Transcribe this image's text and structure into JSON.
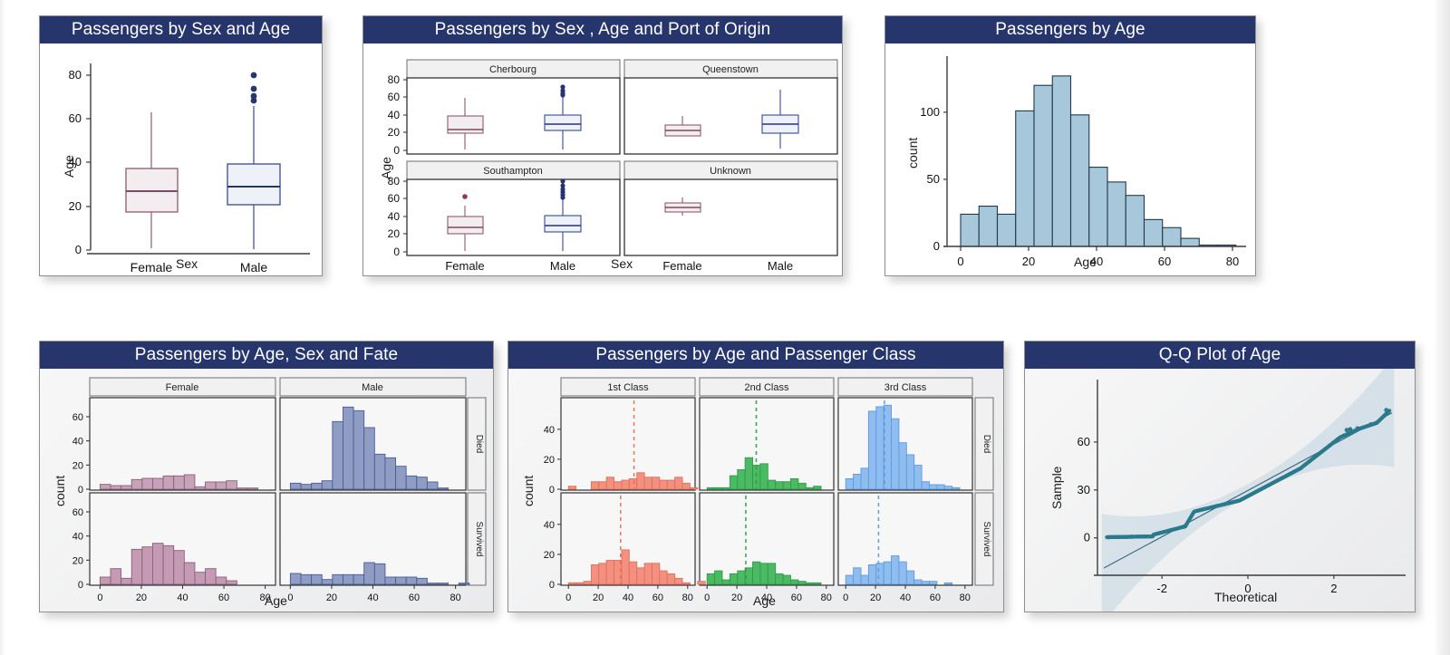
{
  "colors": {
    "header_bg": "#26356c",
    "header_text": "#ffffff",
    "female_line": "#8c5a72",
    "female_fill": "#f3edf0",
    "male_line": "#3a4a8c",
    "male_fill": "#eef1f8",
    "hist_age_fill": "#a7c8da",
    "hist_age_line": "#23394d",
    "died_female_fill": "#c6a3b8",
    "survived_female_fill": "#c49ab4",
    "died_male_fill": "#8f9cc4",
    "class1": "#f4907f",
    "class2": "#4cb963",
    "class3": "#8fbdf0",
    "qq_point": "#2a7b8c",
    "qq_band": "#b7cfdd"
  },
  "panels": [
    {
      "id": "passengers-by-sex-and-age",
      "title": "Passengers by Sex and Age",
      "chart_data": {
        "type": "box",
        "title": "Passengers by Sex and Age",
        "xlabel": "Sex",
        "ylabel": "Age",
        "categories": [
          "Female",
          "Male"
        ],
        "ylim": [
          -5,
          88
        ],
        "yticks": [
          0,
          20,
          40,
          60,
          80
        ],
        "grid": false,
        "boxes": [
          {
            "name": "Female",
            "whisker_low": 1,
            "q1": 18,
            "median": 27,
            "q3": 37,
            "whisker_high": 63,
            "outliers": []
          },
          {
            "name": "Male",
            "whisker_low": 0.5,
            "q1": 21,
            "median": 29,
            "q3": 39,
            "whisker_high": 66,
            "outliers": [
              80,
              74,
              71,
              70.5
            ]
          }
        ]
      }
    },
    {
      "id": "passengers-by-sex-age-port",
      "title": "Passengers by Sex , Age and Port of Origin",
      "chart_data": {
        "type": "box",
        "title": "Passengers by Sex , Age and Port of Origin",
        "xlabel": "Sex",
        "ylabel": "Age",
        "categories": [
          "Female",
          "Male"
        ],
        "facets": [
          "Cherbourg",
          "Queenstown",
          "Southampton",
          "Unknown"
        ],
        "ylim": [
          -5,
          85
        ],
        "yticks": [
          0,
          20,
          40,
          60,
          80
        ],
        "grid": false,
        "panels": [
          {
            "facet": "Cherbourg",
            "boxes": [
              {
                "name": "Female",
                "whisker_low": 1,
                "q1": 19,
                "median": 24,
                "q3": 39,
                "whisker_high": 59,
                "outliers": []
              },
              {
                "name": "Male",
                "whisker_low": 0.5,
                "q1": 25,
                "median": 30,
                "q3": 40,
                "whisker_high": 62,
                "outliers": [
                  71,
                  70,
                  69,
                  66,
                  65
                ]
              }
            ]
          },
          {
            "facet": "Queenstown",
            "boxes": [
              {
                "name": "Female",
                "whisker_low": 19,
                "q1": 21,
                "median": 23,
                "q3": 27,
                "whisker_high": 39,
                "outliers": []
              },
              {
                "name": "Male",
                "whisker_low": 2,
                "q1": 20,
                "median": 30,
                "q3": 40,
                "whisker_high": 70,
                "outliers": []
              }
            ]
          },
          {
            "facet": "Southampton",
            "boxes": [
              {
                "name": "Female",
                "whisker_low": 1,
                "q1": 20,
                "median": 27,
                "q3": 36,
                "whisker_high": 52,
                "outliers": [
                  63
                ]
              },
              {
                "name": "Male",
                "whisker_low": 1,
                "q1": 22,
                "median": 28,
                "q3": 37,
                "whisker_high": 60,
                "outliers": [
                  80,
                  74,
                  71,
                  70,
                  68,
                  66,
                  65
                ]
              }
            ]
          },
          {
            "facet": "Unknown",
            "boxes": [
              {
                "name": "Female",
                "whisker_low": 41,
                "q1": 46,
                "median": 50,
                "q3": 53,
                "whisker_high": 62,
                "outliers": []
              }
            ]
          }
        ]
      }
    },
    {
      "id": "passengers-by-age",
      "title": "Passengers by Age",
      "chart_data": {
        "type": "bar",
        "subtype": "histogram",
        "title": "Passengers by Age",
        "xlabel": "Age",
        "ylabel": "count",
        "bin_width": 5.4,
        "bin_starts": [
          0,
          5.4,
          10.8,
          16.2,
          21.6,
          27,
          32.4,
          37.8,
          43.2,
          48.6,
          54,
          59.4,
          64.8,
          70.2,
          75.6
        ],
        "values": [
          24,
          30,
          24,
          101,
          120,
          127,
          98,
          59,
          48,
          38,
          20,
          14,
          6,
          1,
          1
        ],
        "xticks": [
          0,
          20,
          40,
          60,
          80
        ],
        "yticks": [
          0,
          50,
          100
        ],
        "xlim": [
          -4,
          84
        ],
        "ylim": [
          0,
          135
        ],
        "grid": false
      }
    },
    {
      "id": "passengers-by-age-sex-fate",
      "title": "Passengers by Age, Sex and Fate",
      "chart_data": {
        "type": "bar",
        "subtype": "histogram-facet-grid",
        "title": "Passengers by Age, Sex and Fate",
        "xlabel": "Age",
        "ylabel": "count",
        "col_facets": [
          "Female",
          "Male"
        ],
        "row_facets": [
          "Died",
          "Survived"
        ],
        "xticks": [
          0,
          20,
          40,
          60,
          80
        ],
        "yticks": [
          0,
          20,
          40,
          60
        ],
        "xlim": [
          -5,
          85
        ],
        "ylim": [
          0,
          72
        ],
        "bin_width": 5.1,
        "grid": false,
        "cells": [
          {
            "row": "Died",
            "col": "Female",
            "values": [
              4,
              3,
              3,
              8,
              9,
              9,
              11,
              11,
              12,
              2,
              6,
              6,
              7,
              1,
              1,
              0,
              0,
              0
            ]
          },
          {
            "row": "Died",
            "col": "Male",
            "values": [
              5,
              4,
              5,
              7,
              56,
              68,
              65,
              51,
              29,
              26,
              19,
              11,
              10,
              6,
              1,
              0,
              0,
              0
            ]
          },
          {
            "row": "Survived",
            "col": "Female",
            "values": [
              6,
              13,
              5,
              29,
              31,
              34,
              32,
              28,
              18,
              10,
              13,
              6,
              3,
              0,
              0,
              0,
              0,
              0
            ]
          },
          {
            "row": "Survived",
            "col": "Male",
            "values": [
              9,
              8,
              8,
              4,
              8,
              8,
              8,
              18,
              17,
              6,
              6,
              6,
              5,
              1,
              1,
              0,
              1,
              0
            ]
          }
        ]
      }
    },
    {
      "id": "passengers-by-age-and-class",
      "title": "Passengers by Age and Passenger Class",
      "chart_data": {
        "type": "bar",
        "subtype": "histogram-facet-grid",
        "title": "Passengers by Age and Passenger Class",
        "xlabel": "Age",
        "ylabel": "count",
        "col_facets": [
          "1st Class",
          "2nd Class",
          "3rd Class"
        ],
        "row_facets": [
          "Died",
          "Survived"
        ],
        "xticks": [
          0,
          20,
          40,
          60,
          80
        ],
        "yticks": [
          0,
          20,
          40
        ],
        "xlim": [
          -5,
          85
        ],
        "ylim": [
          0,
          58
        ],
        "bin_width": 5.1,
        "grid": false,
        "mean_lines": [
          {
            "row": "Died",
            "col": "1st Class",
            "x": 44
          },
          {
            "row": "Died",
            "col": "2nd Class",
            "x": 33
          },
          {
            "row": "Died",
            "col": "3rd Class",
            "x": 26
          },
          {
            "row": "Survived",
            "col": "1st Class",
            "x": 35
          },
          {
            "row": "Survived",
            "col": "2nd Class",
            "x": 26
          },
          {
            "row": "Survived",
            "col": "3rd Class",
            "x": 22
          }
        ],
        "cells": [
          {
            "row": "Died",
            "col": "1st Class",
            "values": [
              2,
              0,
              0,
              5,
              5,
              8,
              5,
              6,
              7,
              11,
              8,
              8,
              6,
              6,
              8,
              4,
              1,
              0
            ]
          },
          {
            "row": "Died",
            "col": "2nd Class",
            "values": [
              1,
              1,
              1,
              9,
              13,
              21,
              16,
              17,
              6,
              5,
              5,
              7,
              4,
              1,
              2,
              0,
              0,
              0
            ]
          },
          {
            "row": "Died",
            "col": "3rd Class",
            "values": [
              7,
              10,
              14,
              52,
              55,
              56,
              47,
              31,
              23,
              16,
              5,
              3,
              3,
              2,
              1,
              0,
              0,
              0
            ]
          },
          {
            "row": "Survived",
            "col": "1st Class",
            "values": [
              1,
              1,
              2,
              13,
              14,
              16,
              16,
              23,
              15,
              11,
              14,
              14,
              9,
              7,
              4,
              1,
              0,
              2
            ]
          },
          {
            "row": "Survived",
            "col": "2nd Class",
            "values": [
              7,
              9,
              3,
              7,
              9,
              11,
              15,
              14,
              14,
              7,
              6,
              3,
              2,
              1,
              1,
              0,
              0,
              0
            ]
          },
          {
            "row": "Survived",
            "col": "3rd Class",
            "values": [
              6,
              11,
              6,
              13,
              14,
              15,
              19,
              15,
              9,
              3,
              2,
              2,
              0,
              1,
              0,
              0,
              0,
              0
            ]
          }
        ]
      }
    },
    {
      "id": "qq-plot-of-age",
      "title": "Q-Q Plot of Age",
      "chart_data": {
        "type": "scatter",
        "subtype": "qq-plot",
        "title": "Q-Q Plot of Age",
        "xlabel": "Theoretical",
        "ylabel": "Sample",
        "xticks": [
          -2,
          0,
          2
        ],
        "yticks": [
          0,
          30,
          60
        ],
        "xlim": [
          -3.5,
          3.5
        ],
        "ylim": [
          -20,
          90
        ],
        "grid": false,
        "reference_line": {
          "intercept": 29.7,
          "slope": 14.5
        },
        "confidence_band": true,
        "points_note": "dense monotone quantile trace from (-3.2, 0.4) to (3.2, 80)"
      }
    }
  ]
}
